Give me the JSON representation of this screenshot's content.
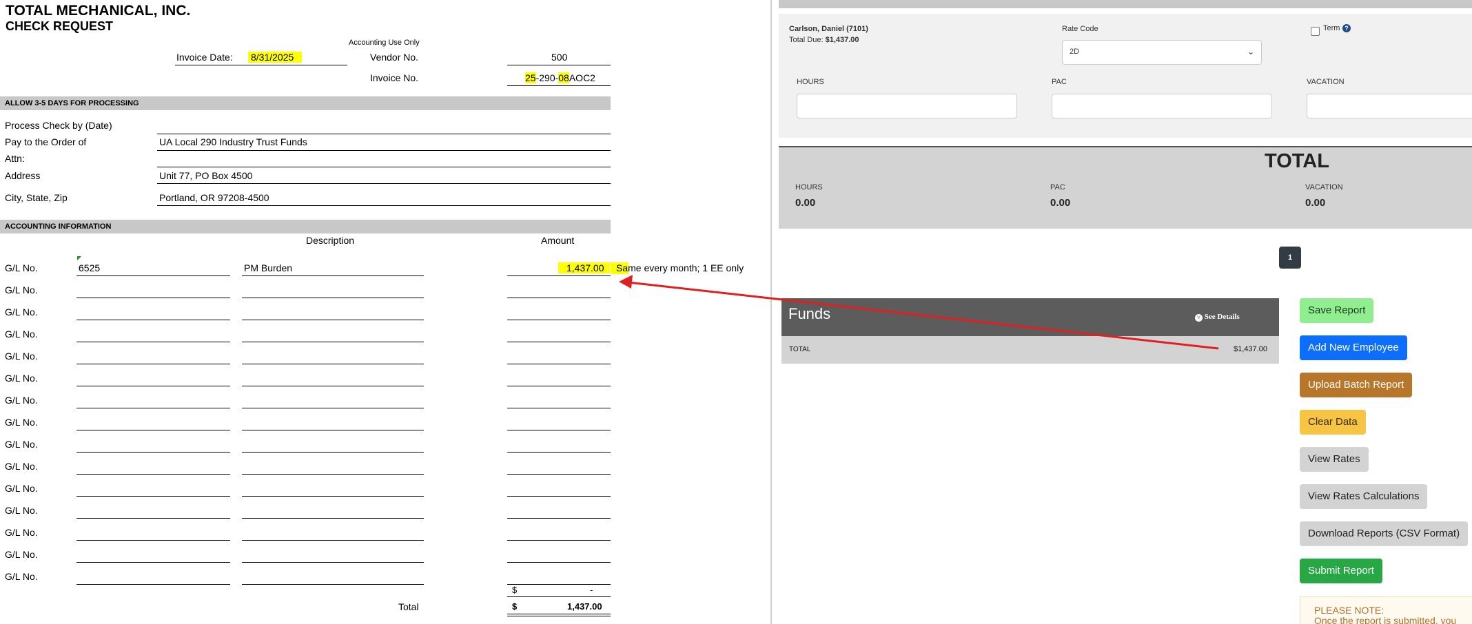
{
  "form": {
    "company": "TOTAL MECHANICAL, INC.",
    "form_title": "CHECK REQUEST",
    "accounting_use_only": "Accounting Use Only",
    "invoice_date_label": "Invoice Date:",
    "invoice_date_value": "8/31/2025",
    "vendor_no_label": "Vendor No.",
    "vendor_no_value": "500",
    "invoice_no_label": "Invoice No.",
    "invoice_no_value": "25-290-08AOC2",
    "band_processing": "ALLOW 3-5 DAYS FOR PROCESSING",
    "process_check_label": "Process Check by (Date)",
    "pay_to_label": "Pay to the Order of",
    "pay_to_value": "UA Local 290 Industry Trust Funds",
    "attn_label": "Attn:",
    "address_label": "Address",
    "address_value": "Unit 77, PO Box 4500",
    "city_label": "City, State, Zip",
    "city_value": "Portland, OR  97208-4500",
    "band_accounting": "ACCOUNTING INFORMATION",
    "col_description": "Description",
    "col_amount": "Amount",
    "gl_label": "G/L No.",
    "first_gl_value": "6525",
    "first_description": "PM Burden",
    "first_amount": "1,437.00",
    "first_note": "Same every month; 1 EE only",
    "subtotal_dollar": "$",
    "subtotal_dash": "-",
    "total_label": "Total",
    "total_dollar": "$",
    "total_value": "1,437.00"
  },
  "report": {
    "employee_name": "Carlson, Daniel (7101)",
    "total_due_label": "Total Due:",
    "total_due_value": "$1,437.00",
    "rate_code_label": "Rate Code",
    "rate_code_value": "2D",
    "term_label": "Term",
    "hours_label": "HOURS",
    "pac_label": "PAC",
    "vacation_label": "VACATION",
    "total_heading": "TOTAL",
    "total_hours_label": "HOURS",
    "total_hours_value": "0.00",
    "total_pac_label": "PAC",
    "total_pac_value": "0.00",
    "total_vacation_label": "VACATION",
    "total_vacation_value": "0.00",
    "page_number": "1",
    "funds_title": "Funds",
    "see_details": "See Details",
    "funds_total_label": "TOTAL",
    "funds_total_value": "$1,437.00",
    "buttons": {
      "save": "Save Report",
      "add_employee": "Add New Employee",
      "upload_batch": "Upload Batch Report",
      "clear": "Clear Data",
      "view_rates": "View Rates",
      "view_rates_calc": "View Rates Calculations",
      "download": "Download Reports (CSV Format)",
      "submit": "Submit Report"
    },
    "note_title": "PLEASE NOTE:",
    "note_text": "Once the report is submitted, you"
  },
  "colors": {
    "highlight": "#ffff00",
    "annotation_arrow": "#e02020",
    "btn_save": "#90ee90",
    "btn_add": "#0d6efd",
    "btn_upload": "#b8762a",
    "btn_clear": "#f7c544",
    "btn_gray": "#d3d3d3",
    "btn_submit": "#28a745"
  }
}
